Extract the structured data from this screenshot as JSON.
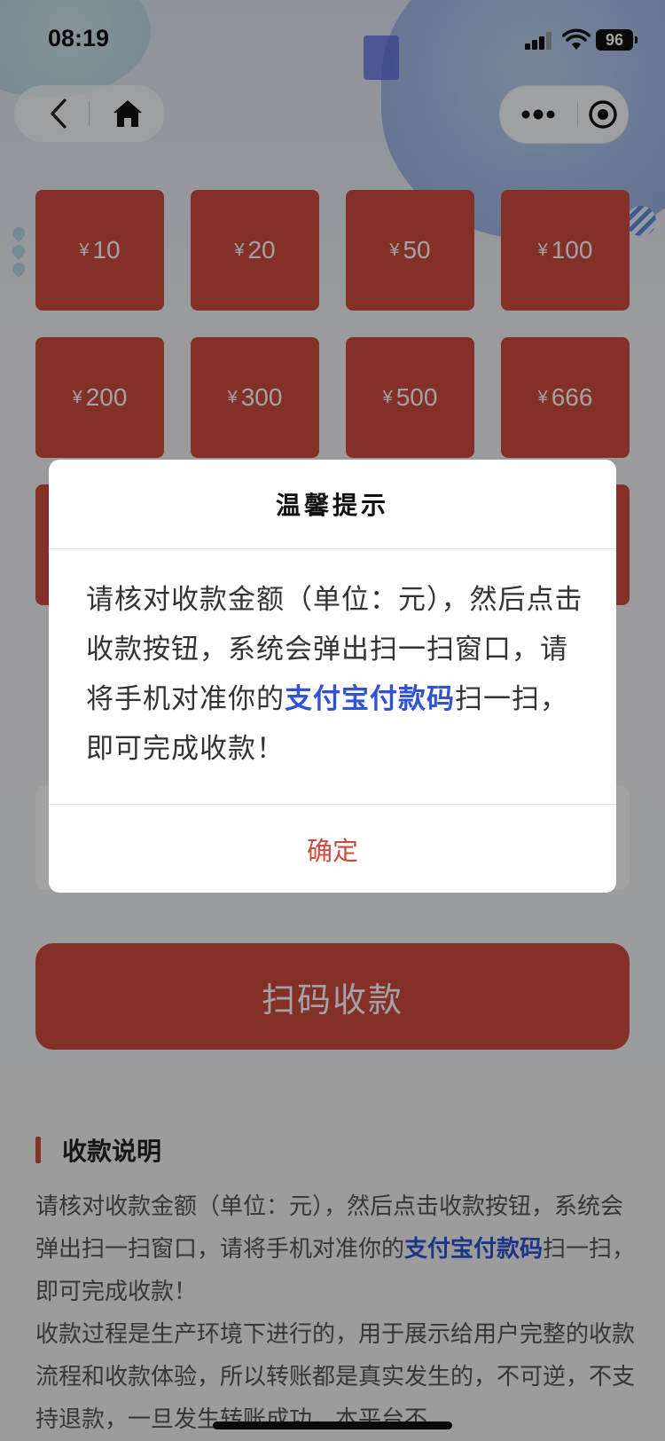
{
  "status_bar": {
    "time": "08:19",
    "battery": "96"
  },
  "nav": {
    "back_icon": "chevron-left-icon",
    "home_icon": "home-icon",
    "more_icon": "more-dots-icon",
    "close_icon": "target-close-icon"
  },
  "amounts": [
    {
      "symbol": "¥",
      "value": "10"
    },
    {
      "symbol": "¥",
      "value": "20"
    },
    {
      "symbol": "¥",
      "value": "50"
    },
    {
      "symbol": "¥",
      "value": "100"
    },
    {
      "symbol": "¥",
      "value": "200"
    },
    {
      "symbol": "¥",
      "value": "300"
    },
    {
      "symbol": "¥",
      "value": "500"
    },
    {
      "symbol": "¥",
      "value": "666"
    }
  ],
  "scan_button": {
    "label": "扫码收款"
  },
  "instructions": {
    "title": "收款说明",
    "line1_prefix": "请核对收款金额（单位：元），然后点击收款按钮，系统会弹出扫一扫窗口，请将手机对准你的",
    "line1_highlight": "支付宝付款码",
    "line1_suffix": "扫一扫，即可完成收款！",
    "line2": "收款过程是生产环境下进行的，用于展示给用户完整的收款流程和收款体验，所以转账都是真实发生的，不可逆，不支持退款，一旦发生转账成功，本平台不"
  },
  "modal": {
    "title": "温馨提示",
    "body_prefix": "请核对收款金额（单位：元），然后点击收款按钮，系统会弹出扫一扫窗口，请将手机对准你的",
    "body_highlight": "支付宝付款码",
    "body_suffix": "扫一扫，即可完成收款！",
    "confirm_label": "确定"
  },
  "colors": {
    "accent": "#cc4b3f",
    "highlight": "#2f53d4"
  }
}
